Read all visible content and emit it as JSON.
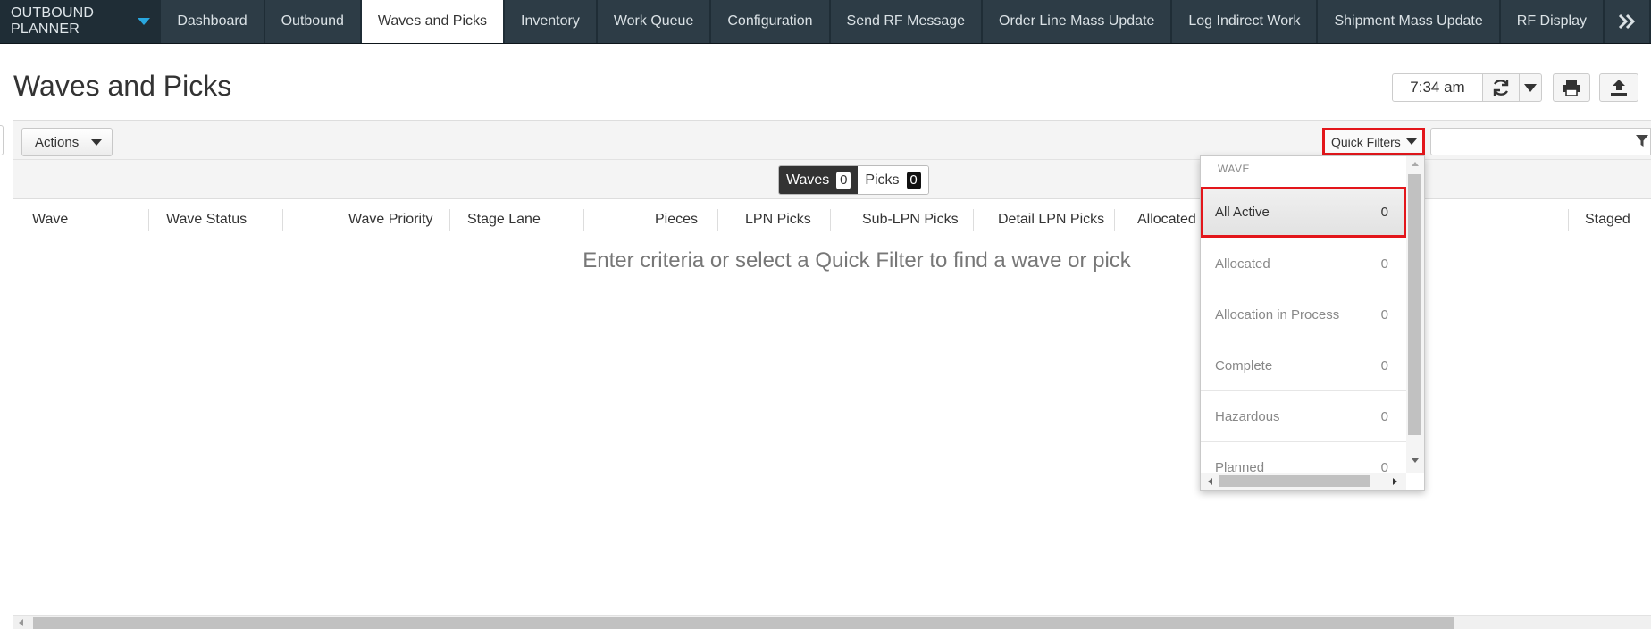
{
  "app": {
    "brand": "OUTBOUND PLANNER",
    "tabs": [
      {
        "label": "Dashboard"
      },
      {
        "label": "Outbound"
      },
      {
        "label": "Waves and Picks"
      },
      {
        "label": "Inventory"
      },
      {
        "label": "Work Queue"
      },
      {
        "label": "Configuration"
      },
      {
        "label": "Send RF Message"
      },
      {
        "label": "Order Line Mass Update"
      },
      {
        "label": "Log Indirect Work"
      },
      {
        "label": "Shipment Mass Update"
      },
      {
        "label": "RF Display"
      }
    ],
    "more_glyph": "»",
    "active_tab": "Waves and Picks"
  },
  "page": {
    "title": "Waves and Picks",
    "time": "7:34 am"
  },
  "toolbar": {
    "actions_label": "Actions",
    "quick_filters_label": "Quick Filters",
    "search_value": ""
  },
  "toggle": {
    "waves_label": "Waves",
    "waves_count": "0",
    "picks_label": "Picks",
    "picks_count": "0",
    "selected": "Waves"
  },
  "table": {
    "columns": [
      "Wave",
      "Wave Status",
      "Wave Priority",
      "Stage Lane",
      "Pieces",
      "LPN Picks",
      "Sub-LPN Picks",
      "Detail LPN Picks",
      "Allocated",
      "Staged"
    ],
    "empty_message": "Enter criteria or select a Quick Filter to find a wave or pick"
  },
  "quick_filters_menu": {
    "group_header": "WAVE",
    "items": [
      {
        "label": "All Active",
        "count": "0"
      },
      {
        "label": "Allocated",
        "count": "0"
      },
      {
        "label": "Allocation in Process",
        "count": "0"
      },
      {
        "label": "Complete",
        "count": "0"
      },
      {
        "label": "Hazardous",
        "count": "0"
      },
      {
        "label": "Planned",
        "count": "0"
      }
    ],
    "selected": "All Active"
  },
  "icons": {
    "brand_caret": "chevron-down-icon",
    "more_tabs": "double-chevron-right-icon",
    "refresh": "refresh-icon",
    "refresh_dropdown": "caret-down-icon",
    "print": "print-icon",
    "export": "upload-icon",
    "filter": "filter-icon"
  },
  "colors": {
    "nav_bg": "#1f2d36",
    "tab_bg": "#2d3c46",
    "accent_caret": "#29a7df",
    "highlight_red": "#e3161b"
  }
}
